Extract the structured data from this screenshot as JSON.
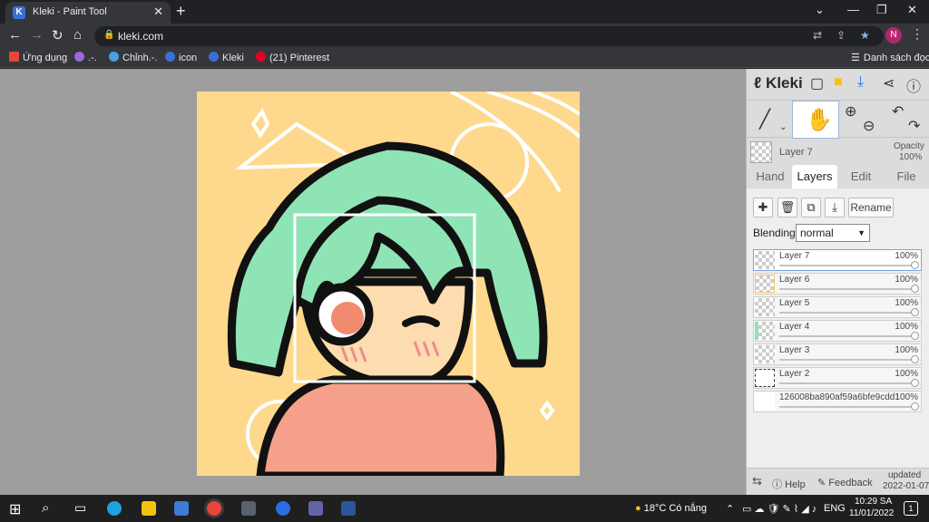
{
  "browser": {
    "tab_title": "Kleki - Paint Tool",
    "tab_favicon": "K",
    "url": "kleki.com",
    "profile_initial": "N",
    "bookmarks": [
      {
        "label": "Ứng dụng",
        "color": "#e8453c"
      },
      {
        "label": ".-.",
        "color": "#9a6bd6"
      },
      {
        "label": "Chỉnh.-.",
        "color": "#4aa0e0"
      },
      {
        "label": "icon",
        "color": "#3b6fd8"
      },
      {
        "label": "Kleki",
        "color": "#3b6fd8"
      },
      {
        "label": "(21) Pinterest",
        "color": "#e60023"
      }
    ],
    "reading_list": "Danh sách đọc"
  },
  "kleki": {
    "logo": "Kleki",
    "current_layer": {
      "name": "Layer 7",
      "opacity_label": "Opacity",
      "opacity_value": "100%"
    },
    "tabs": [
      "Hand",
      "Layers",
      "Edit",
      "File"
    ],
    "active_tab": "Layers",
    "rename_label": "Rename",
    "blending_label": "Blending",
    "blending_value": "normal",
    "layers": [
      {
        "name": "Layer 7",
        "opacity": "100%",
        "selected": true
      },
      {
        "name": "Layer 6",
        "opacity": "100%",
        "selected": false
      },
      {
        "name": "Layer 5",
        "opacity": "100%",
        "selected": false
      },
      {
        "name": "Layer 4",
        "opacity": "100%",
        "selected": false
      },
      {
        "name": "Layer 3",
        "opacity": "100%",
        "selected": false
      },
      {
        "name": "Layer 2",
        "opacity": "100%",
        "selected": false
      },
      {
        "name": "126008ba890af59a6bfe9cdd1",
        "opacity": "100%",
        "selected": false
      }
    ],
    "footer": {
      "help": "Help",
      "feedback": "Feedback",
      "updated_label": "updated",
      "updated_date": "2022-01-07"
    }
  },
  "taskbar": {
    "weather": "18°C Có nắng",
    "language": "ENG",
    "time": "10:29 SA",
    "date": "11/01/2022",
    "notification_count": "1"
  }
}
